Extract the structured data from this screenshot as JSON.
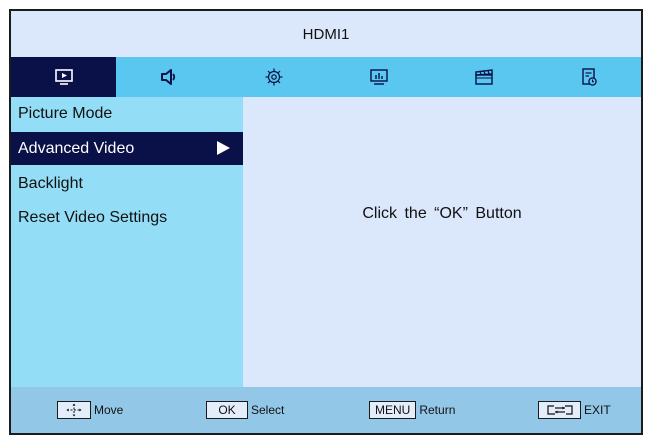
{
  "header": {
    "title": "HDMI1"
  },
  "tabs": [
    {
      "icon": "picture-icon",
      "active": true
    },
    {
      "icon": "speaker-icon",
      "active": false
    },
    {
      "icon": "gear-icon",
      "active": false
    },
    {
      "icon": "chart-icon",
      "active": false
    },
    {
      "icon": "clapperboard-icon",
      "active": false
    },
    {
      "icon": "timer-icon",
      "active": false
    }
  ],
  "sidebar": {
    "items": [
      {
        "label": "Picture Mode"
      },
      {
        "label": "Advanced Video",
        "selected": true
      },
      {
        "label": "Backlight"
      },
      {
        "label": "Reset Video Settings"
      }
    ]
  },
  "content": {
    "hint": "Click  the  “OK”  Button"
  },
  "footer": {
    "move": {
      "icon": "dpad-icon",
      "label": "Move"
    },
    "select": {
      "key": "OK",
      "label": "Select"
    },
    "return": {
      "key": "MENU",
      "label": "Return"
    },
    "exit": {
      "icon": "exit-icon",
      "label": "EXIT"
    }
  },
  "colors": {
    "tab_bar": "#59c7ef",
    "active_dark": "#0a1048",
    "sidebar": "#93ddf6",
    "content": "#dbe8fc",
    "footer": "#93c7e8"
  }
}
